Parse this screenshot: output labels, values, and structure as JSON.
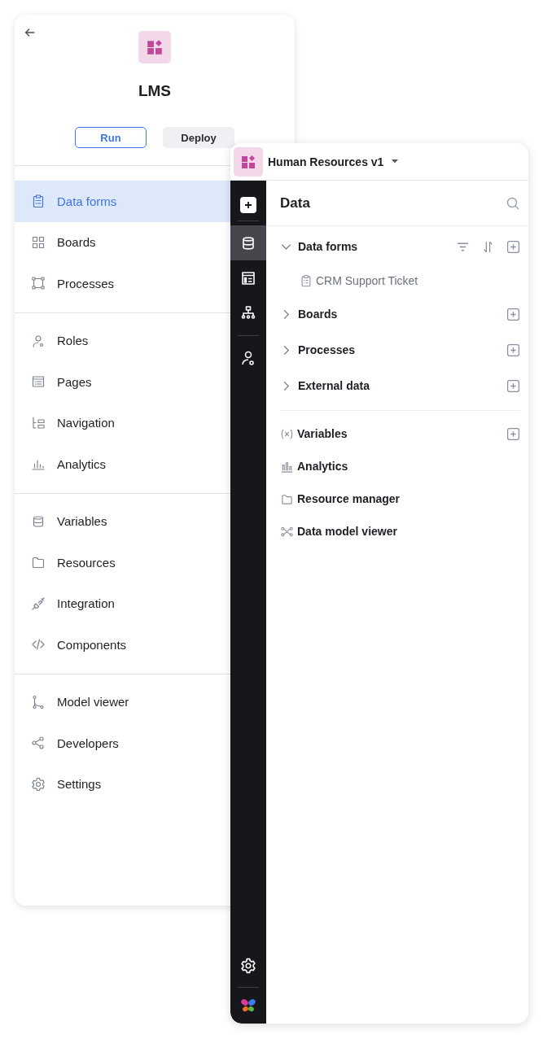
{
  "app": {
    "title": "LMS",
    "buttons": [
      {
        "label": "Run",
        "kind": "outline"
      },
      {
        "label": "Deploy",
        "kind": "filled"
      }
    ],
    "nav_groups": [
      {
        "items": [
          {
            "label": "Data forms",
            "selected": true
          },
          {
            "label": "Boards",
            "selected": false
          },
          {
            "label": "Processes",
            "selected": false
          }
        ]
      },
      {
        "items": [
          {
            "label": "Roles",
            "selected": false
          },
          {
            "label": "Pages",
            "selected": false
          },
          {
            "label": "Navigation",
            "selected": false
          },
          {
            "label": "Analytics",
            "selected": false
          }
        ]
      },
      {
        "items": [
          {
            "label": "Variables",
            "selected": false
          },
          {
            "label": "Resources",
            "selected": false
          },
          {
            "label": "Integration",
            "selected": false
          },
          {
            "label": "Components",
            "selected": false
          }
        ]
      },
      {
        "items": [
          {
            "label": "Model viewer",
            "selected": false
          },
          {
            "label": "Developers",
            "selected": false
          },
          {
            "label": "Settings",
            "selected": false
          }
        ]
      }
    ]
  },
  "project": {
    "title": "Human Resources v1",
    "rail": [
      {
        "selected": true
      },
      {
        "selected": false
      },
      {
        "selected": false
      },
      {
        "selected": false
      }
    ],
    "data_panel": {
      "title": "Data",
      "sections": [
        {
          "label": "Data forms",
          "expanded": true,
          "sortable": true,
          "children": [
            {
              "label": "CRM Support Ticket"
            }
          ]
        },
        {
          "label": "Boards",
          "expanded": false,
          "sortable": false
        },
        {
          "label": "Processes",
          "expanded": false,
          "sortable": false
        },
        {
          "label": "External data",
          "expanded": false,
          "sortable": false
        }
      ],
      "tools": [
        {
          "label": "Variables",
          "addable": true
        },
        {
          "label": "Analytics",
          "addable": false
        },
        {
          "label": "Resource manager",
          "addable": false
        },
        {
          "label": "Data model viewer",
          "addable": false
        }
      ]
    }
  }
}
